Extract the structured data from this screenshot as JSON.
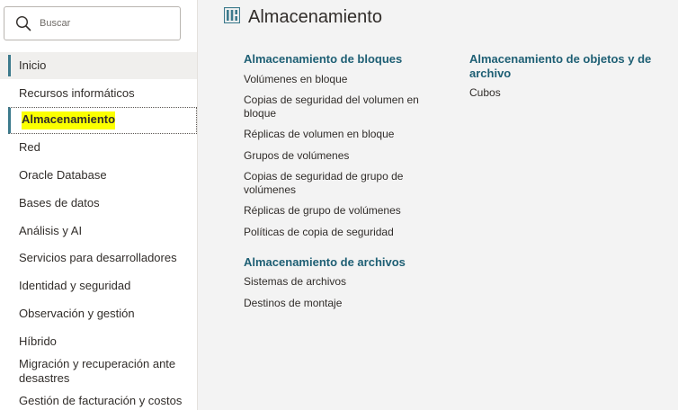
{
  "search": {
    "placeholder": "Buscar",
    "icon": "search-icon"
  },
  "sidebar": {
    "items": [
      {
        "label": "Inicio"
      },
      {
        "label": "Recursos informáticos"
      },
      {
        "label": "Almacenamiento"
      },
      {
        "label": "Red"
      },
      {
        "label": "Oracle Database"
      },
      {
        "label": "Bases de datos"
      },
      {
        "label": "Análisis y AI"
      },
      {
        "label": "Servicios para desarrolladores"
      },
      {
        "label": "Identidad y seguridad"
      },
      {
        "label": "Observación y gestión"
      },
      {
        "label": "Híbrido"
      },
      {
        "label": "Migración y recuperación ante desastres"
      },
      {
        "label": "Gestión de facturación y costos"
      }
    ],
    "active_index": 2
  },
  "main": {
    "title": "Almacenamiento",
    "title_icon": "storage-icon",
    "sections": [
      {
        "title": "Almacenamiento de bloques",
        "links": [
          "Volúmenes en bloque",
          "Copias de seguridad del volumen en bloque",
          "Réplicas de volumen en bloque",
          "Grupos de volúmenes",
          "Copias de seguridad de grupo de volúmenes",
          "Réplicas de grupo de volúmenes",
          "Políticas de copia de seguridad"
        ]
      },
      {
        "title": "Almacenamiento de archivos",
        "links": [
          "Sistemas de archivos",
          "Destinos de montaje"
        ]
      },
      {
        "title": "Almacenamiento de objetos y de archivo",
        "links": [
          "Cubos"
        ]
      }
    ]
  },
  "colors": {
    "accent": "#3c7a8c",
    "section_title": "#1e5f74",
    "highlight": "#fbff00",
    "background": "#f3f3f3"
  }
}
